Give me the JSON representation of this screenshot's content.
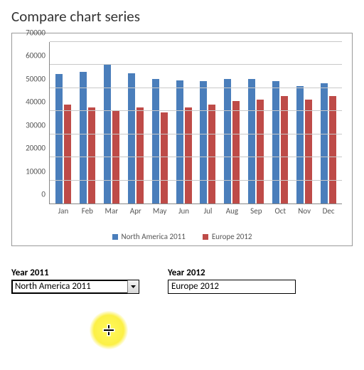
{
  "title": "Compare chart series",
  "chart_data": {
    "type": "bar",
    "categories": [
      "Jan",
      "Feb",
      "Mar",
      "Apr",
      "May",
      "Jun",
      "Jul",
      "Aug",
      "Sep",
      "Oct",
      "Nov",
      "Dec"
    ],
    "series": [
      {
        "name": "North America 2011",
        "values": [
          56000,
          57000,
          60000,
          56500,
          54000,
          53500,
          53000,
          54000,
          54000,
          53000,
          51000,
          52000
        ]
      },
      {
        "name": "Europe 2012",
        "values": [
          43000,
          41500,
          40000,
          41500,
          39500,
          41500,
          43000,
          44500,
          45000,
          46500,
          45000,
          46500
        ]
      }
    ],
    "ylim": [
      0,
      70000
    ],
    "yticks": [
      0,
      10000,
      20000,
      30000,
      40000,
      50000,
      60000,
      70000
    ],
    "xlabel": "",
    "ylabel": "",
    "title": ""
  },
  "controls": {
    "left": {
      "label": "Year 2011",
      "value": "North America 2011"
    },
    "right": {
      "label": "Year 2012",
      "value": "Europe 2012"
    }
  }
}
